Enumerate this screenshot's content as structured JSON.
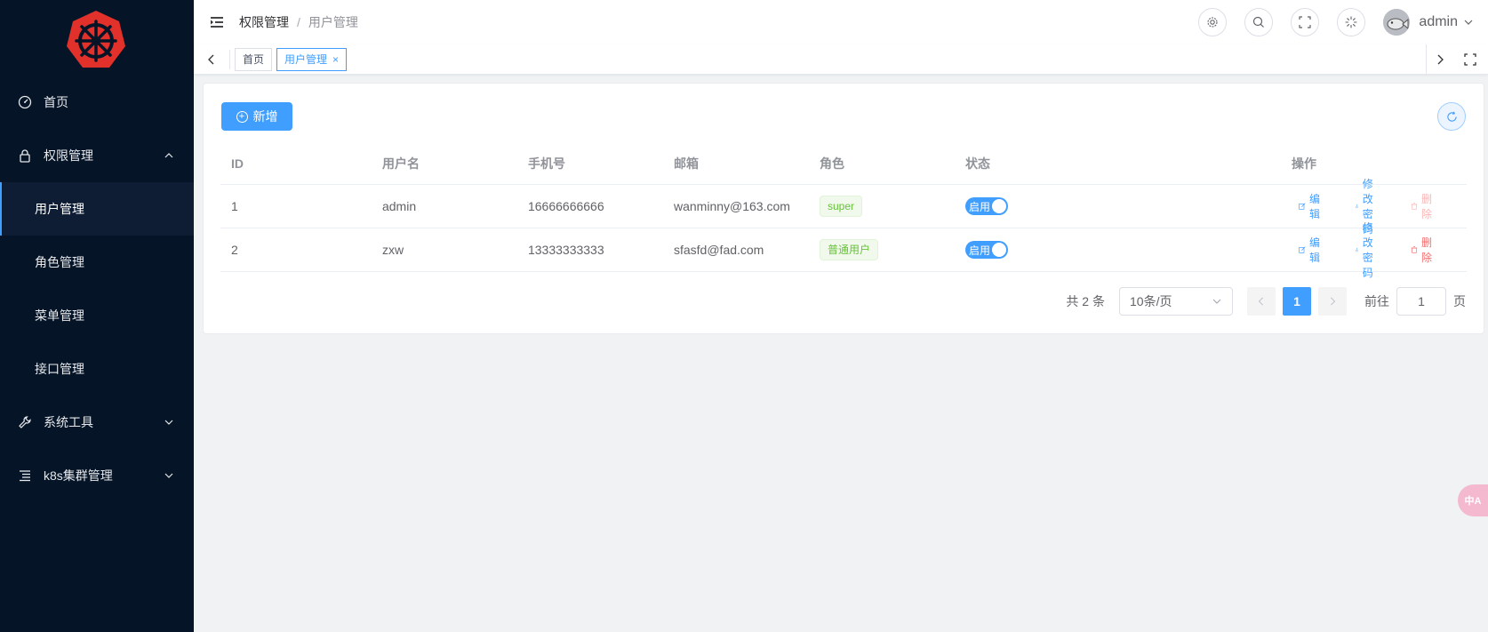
{
  "colors": {
    "primary": "#409eff",
    "sidebar_bg": "#051427",
    "success": "#67c23a",
    "danger": "#f56c6c",
    "logo": "#e2302a"
  },
  "sidebar": {
    "items": [
      {
        "label": "首页",
        "icon": "dashboard-icon"
      },
      {
        "label": "权限管理",
        "icon": "lock-icon",
        "expanded": true,
        "children": [
          {
            "label": "用户管理",
            "active": true
          },
          {
            "label": "角色管理"
          },
          {
            "label": "菜单管理"
          },
          {
            "label": "接口管理"
          }
        ]
      },
      {
        "label": "系统工具",
        "icon": "wrench-icon",
        "expanded": false
      },
      {
        "label": "k8s集群管理",
        "icon": "list-icon",
        "expanded": false
      }
    ]
  },
  "header": {
    "breadcrumb": [
      "权限管理",
      "用户管理"
    ],
    "breadcrumb_sep": "/",
    "username": "admin"
  },
  "tabs": [
    {
      "label": "首页",
      "active": false
    },
    {
      "label": "用户管理",
      "active": true,
      "close": "×"
    }
  ],
  "toolbar": {
    "add_label": "新增"
  },
  "table": {
    "headers": [
      "ID",
      "用户名",
      "手机号",
      "邮箱",
      "角色",
      "状态",
      "操作"
    ],
    "rows": [
      {
        "id": "1",
        "username": "admin",
        "phone": "16666666666",
        "email": "wanminny@163.com",
        "role": "super",
        "status": "启用",
        "edit": "编辑",
        "change_pwd": "修改密码",
        "delete": "删除",
        "delete_disabled": true
      },
      {
        "id": "2",
        "username": "zxw",
        "phone": "13333333333",
        "email": "sfasfd@fad.com",
        "role": "普通用户",
        "status": "启用",
        "edit": "编辑",
        "change_pwd": "修改密码",
        "delete": "删除",
        "delete_disabled": false
      }
    ]
  },
  "pagination": {
    "total_text": "共 2 条",
    "page_size": "10条/页",
    "current_page": "1",
    "goto_label": "前往",
    "goto_value": "1",
    "page_unit": "页"
  },
  "floating_badge": "中A"
}
